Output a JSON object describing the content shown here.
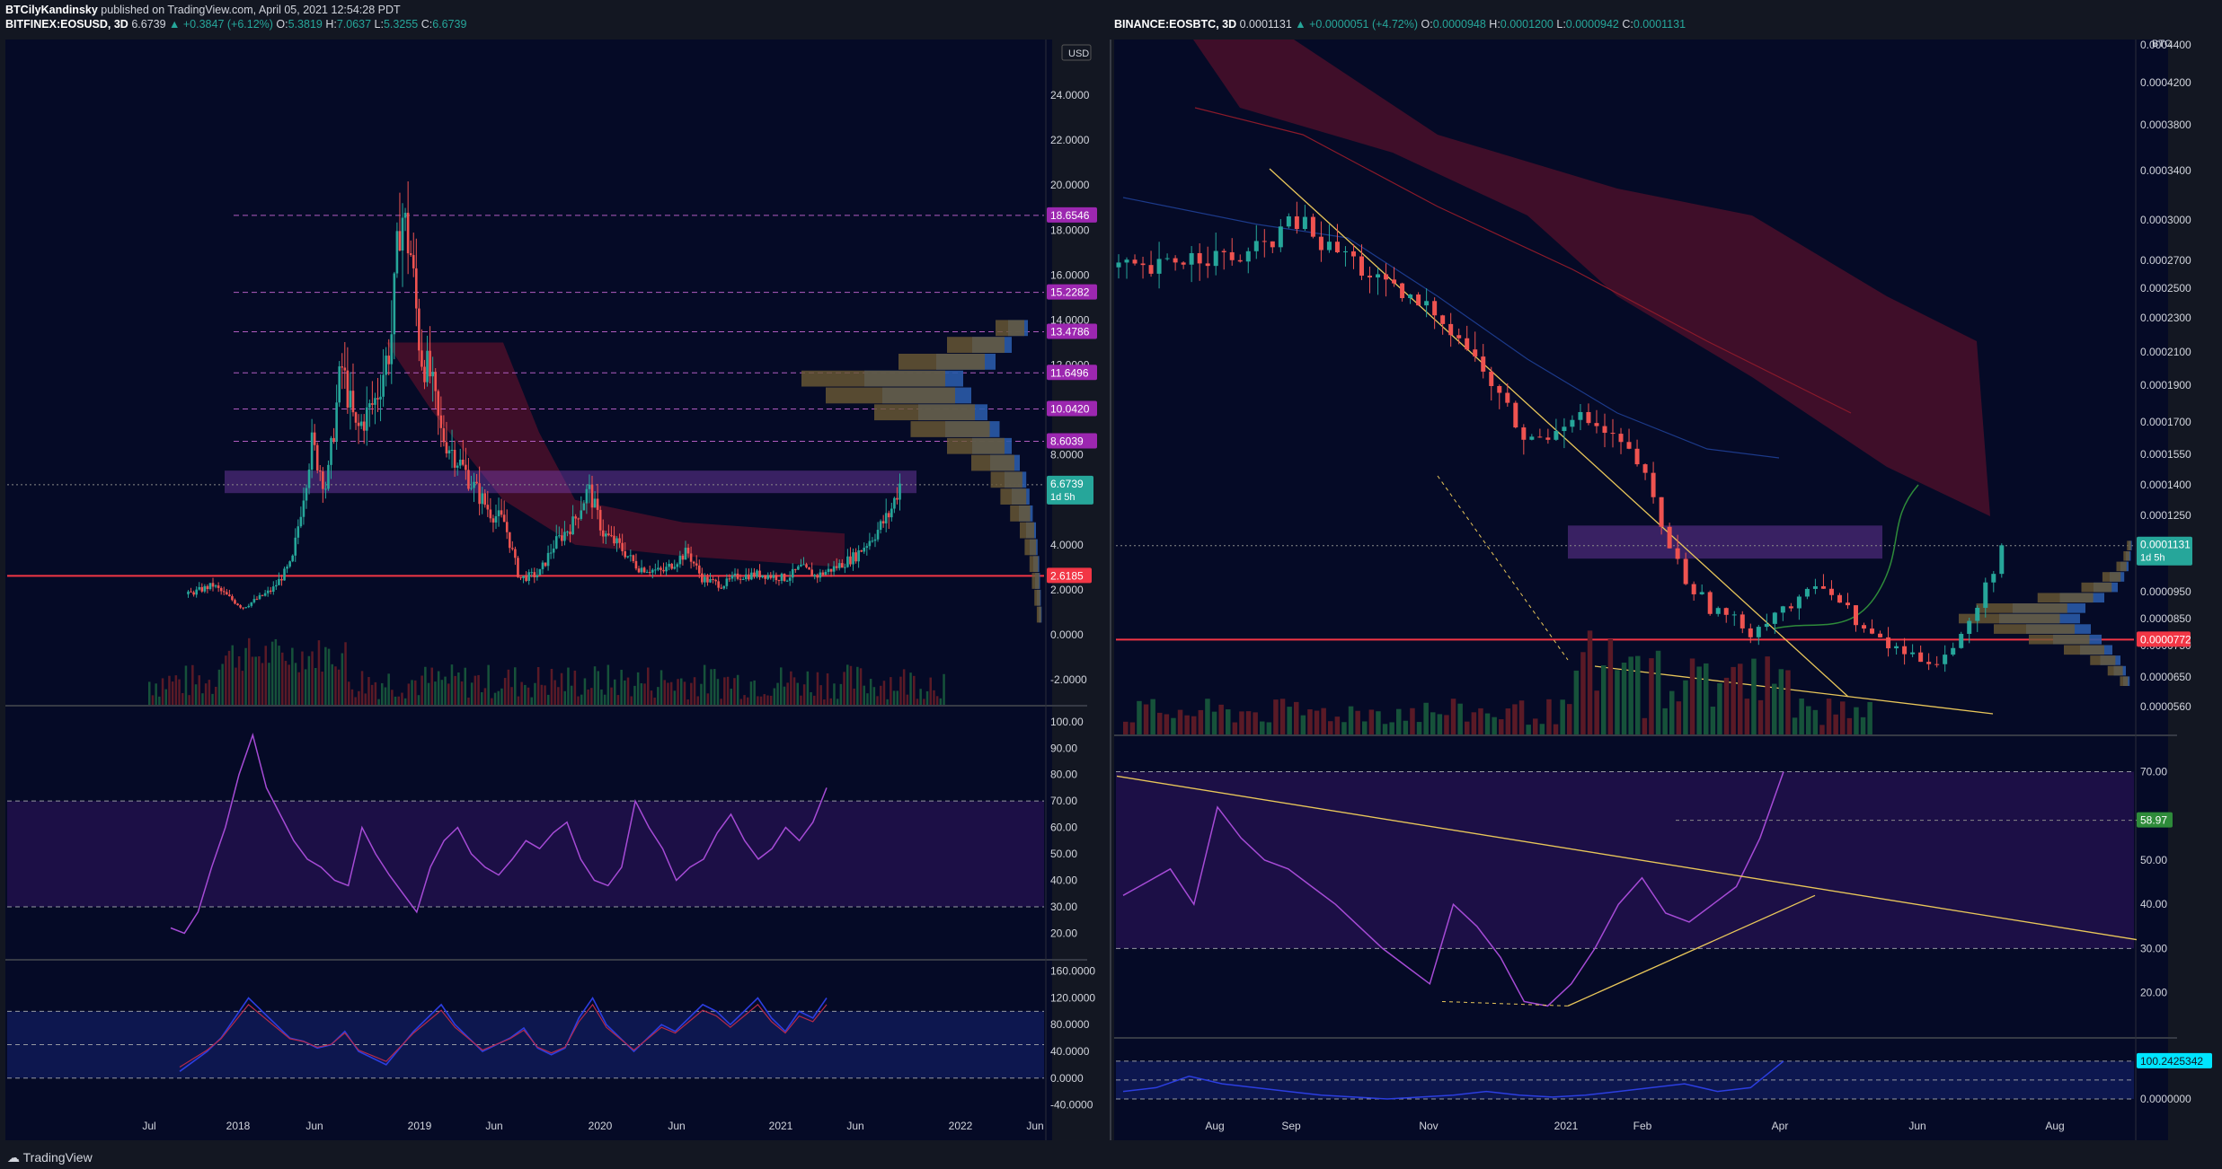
{
  "header": {
    "author": "BTCilyKandinsky",
    "published": "published on TradingView.com, April 05, 2021 12:54:28 PDT"
  },
  "left_chart": {
    "symbol": "BITFINEX:EOSUSD, 3D",
    "last": "6.6739",
    "change": "▲ +0.3847 (+6.12%)",
    "open": "5.3819",
    "high": "7.0637",
    "low": "5.3255",
    "close": "6.6739",
    "currency": "USD",
    "countdown": "1d 5h",
    "price_tag_color": "#26a69a",
    "level_tag_color": "#9c27b0",
    "support_color": "#f23645"
  },
  "right_chart": {
    "symbol": "BINANCE:EOSBTC, 3D",
    "last": "0.0001131",
    "change": "▲ +0.0000051 (+4.72%)",
    "open": "0.0000948",
    "high": "0.0001200",
    "low": "0.0000942",
    "close": "0.0001131",
    "currency": "BTC",
    "countdown": "1d 5h",
    "rsi_value": "58.97",
    "osc_value": "100.2425342"
  },
  "footer": {
    "brand": "TradingView"
  },
  "chart_data": [
    {
      "type": "candlestick",
      "panel": "left-price",
      "symbol": "BITFINEX:EOSUSD",
      "x_ticks": [
        "Jul",
        "2018",
        "Jun",
        "2019",
        "Jun",
        "2020",
        "Jun",
        "2021",
        "Jun",
        "2022",
        "Jun"
      ],
      "y_ticks": [
        "24.0000",
        "22.0000",
        "20.0000",
        "18.0000",
        "16.0000",
        "14.0000",
        "12.0000",
        "10.0000",
        "8.0000",
        "4.0000",
        "2.0000",
        "0.0000",
        "-2.0000"
      ],
      "ylim": [
        -2,
        26
      ],
      "level_labels": [
        "18.6546",
        "15.2282",
        "13.4786",
        "11.6496",
        "10.0420",
        "8.6039"
      ],
      "level_values": [
        18.6546,
        15.2282,
        13.4786,
        11.6496,
        10.042,
        8.6039
      ],
      "support_label": "2.6185",
      "support_value": 2.6185,
      "last_value": 6.6739,
      "close_path": [
        [
          0.9,
          1.8
        ],
        [
          1.4,
          2.2
        ],
        [
          2.0,
          1.2
        ],
        [
          2.6,
          2.0
        ],
        [
          3.0,
          3.2
        ],
        [
          3.4,
          8.5
        ],
        [
          3.7,
          6.5
        ],
        [
          4.0,
          12.0
        ],
        [
          4.3,
          9.0
        ],
        [
          4.7,
          10.5
        ],
        [
          5.0,
          13.0
        ],
        [
          5.2,
          19.0
        ],
        [
          5.4,
          17.0
        ],
        [
          5.6,
          12.5
        ],
        [
          5.8,
          11.5
        ],
        [
          6.0,
          9.0
        ],
        [
          6.3,
          8.0
        ],
        [
          6.7,
          6.5
        ],
        [
          7.0,
          5.5
        ],
        [
          7.3,
          5.0
        ],
        [
          7.6,
          2.5
        ],
        [
          8.0,
          2.7
        ],
        [
          8.3,
          4.0
        ],
        [
          8.7,
          5.0
        ],
        [
          9.0,
          6.5
        ],
        [
          9.3,
          4.5
        ],
        [
          9.6,
          4.0
        ],
        [
          10.0,
          3.0
        ],
        [
          10.5,
          2.8
        ],
        [
          11.0,
          3.7
        ],
        [
          11.3,
          2.5
        ],
        [
          11.7,
          2.2
        ],
        [
          12.0,
          2.6
        ],
        [
          12.5,
          2.7
        ],
        [
          13.0,
          2.5
        ],
        [
          13.3,
          3.0
        ],
        [
          13.6,
          2.6
        ],
        [
          14.0,
          3.0
        ],
        [
          14.4,
          3.5
        ],
        [
          14.8,
          4.5
        ],
        [
          15.1,
          5.4
        ],
        [
          15.3,
          6.7
        ]
      ],
      "volume_profile_pct": [
        0.2,
        0.4,
        0.6,
        1.0,
        0.9,
        0.7,
        0.55,
        0.4,
        0.3,
        0.22,
        0.18,
        0.14,
        0.1,
        0.08,
        0.06,
        0.05,
        0.04,
        0.03
      ]
    },
    {
      "type": "line",
      "panel": "left-rsi",
      "y_ticks": [
        "100.00",
        "90.00",
        "80.00",
        "70.00",
        "60.00",
        "50.00",
        "40.00",
        "30.00",
        "20.00"
      ],
      "ylim": [
        13,
        103
      ],
      "bands": [
        30,
        70
      ],
      "values": [
        22,
        20,
        28,
        45,
        60,
        80,
        95,
        75,
        65,
        55,
        48,
        45,
        40,
        38,
        60,
        50,
        42,
        35,
        28,
        45,
        55,
        60,
        50,
        45,
        42,
        48,
        55,
        52,
        58,
        62,
        48,
        40,
        38,
        45,
        70,
        60,
        52,
        40,
        45,
        48,
        58,
        65,
        55,
        48,
        52,
        60,
        55,
        62,
        75
      ]
    },
    {
      "type": "line",
      "panel": "left-osc",
      "y_ticks": [
        "160.0000",
        "120.0000",
        "80.0000",
        "40.0000",
        "0.0000",
        "-40.0000"
      ],
      "ylim": [
        -42,
        165
      ],
      "bands": [
        0,
        50,
        100
      ],
      "values": [
        10,
        25,
        40,
        60,
        90,
        120,
        100,
        80,
        60,
        55,
        45,
        50,
        70,
        40,
        30,
        20,
        45,
        70,
        90,
        110,
        80,
        60,
        40,
        50,
        60,
        75,
        45,
        35,
        45,
        90,
        120,
        80,
        60,
        40,
        60,
        80,
        70,
        90,
        110,
        100,
        80,
        100,
        120,
        90,
        70,
        100,
        90,
        120
      ]
    },
    {
      "type": "candlestick",
      "panel": "right-price",
      "symbol": "BINANCE:EOSBTC",
      "x_ticks": [
        "Aug",
        "Sep",
        "Nov",
        "2021",
        "Feb",
        "Apr",
        "Jun",
        "Aug"
      ],
      "y_ticks": [
        "0.0004400",
        "0.0004200",
        "0.0003800",
        "0.0003400",
        "0.0003000",
        "0.0002700",
        "0.0002500",
        "0.0002300",
        "0.0002100",
        "0.0001900",
        "0.0001700",
        "0.0001550",
        "0.0001400",
        "0.0001250",
        "0.0000950",
        "0.0000850",
        "0.0000750",
        "0.0000650",
        "0.0000560"
      ],
      "ylim": [
        5e-05,
        0.00045
      ],
      "support_label": "0.0000772",
      "support_value": 7.72e-05,
      "last_value": 0.0001131,
      "close_path": [
        [
          0.0,
          0.000265
        ],
        [
          0.5,
          0.00026
        ],
        [
          1.0,
          0.00027
        ],
        [
          1.5,
          0.000275
        ],
        [
          2.0,
          0.00027
        ],
        [
          2.4,
          0.000275
        ],
        [
          2.8,
          0.00029
        ],
        [
          3.2,
          0.0003
        ],
        [
          3.6,
          0.00028
        ],
        [
          4.0,
          0.000275
        ],
        [
          4.4,
          0.00026
        ],
        [
          4.8,
          0.000248
        ],
        [
          5.2,
          0.00024
        ],
        [
          5.6,
          0.000235
        ],
        [
          6.0,
          0.00022
        ],
        [
          6.4,
          0.0002
        ],
        [
          6.8,
          0.00018
        ],
        [
          7.2,
          0.00016
        ],
        [
          7.6,
          0.000165
        ],
        [
          8.0,
          0.000175
        ],
        [
          8.4,
          0.000168
        ],
        [
          8.8,
          0.00016
        ],
        [
          9.2,
          0.00015
        ],
        [
          9.6,
          0.00012
        ],
        [
          10.0,
          0.0001
        ],
        [
          10.4,
          9e-05
        ],
        [
          10.8,
          8.5e-05
        ],
        [
          11.2,
          8e-05
        ],
        [
          11.6,
          8.8e-05
        ],
        [
          12.0,
          9e-05
        ],
        [
          12.4,
          0.0001
        ],
        [
          12.8,
          9e-05
        ],
        [
          13.2,
          8e-05
        ],
        [
          13.6,
          7.5e-05
        ],
        [
          14.0,
          7.2e-05
        ],
        [
          14.4,
          7e-05
        ],
        [
          14.8,
          7.5e-05
        ],
        [
          15.2,
          9e-05
        ],
        [
          15.6,
          0.000113
        ]
      ],
      "volume_profile_pct": [
        0.04,
        0.06,
        0.1,
        0.18,
        0.3,
        0.55,
        0.9,
        1.0,
        0.8,
        0.6,
        0.4,
        0.25,
        0.15,
        0.08
      ]
    },
    {
      "type": "line",
      "panel": "right-rsi",
      "y_ticks": [
        "70.00",
        "50.00",
        "40.00",
        "30.00",
        "20.00"
      ],
      "ylim": [
        12,
        76
      ],
      "bands": [
        30,
        70
      ],
      "values": [
        42,
        45,
        48,
        40,
        62,
        55,
        50,
        48,
        44,
        40,
        35,
        30,
        26,
        22,
        40,
        35,
        28,
        18,
        17,
        22,
        30,
        40,
        46,
        38,
        36,
        40,
        44,
        55,
        70
      ]
    },
    {
      "type": "line",
      "panel": "right-osc",
      "y_ticks": [
        "0.0000000"
      ],
      "values": [
        20,
        30,
        60,
        40,
        30,
        20,
        10,
        5,
        0,
        5,
        10,
        20,
        10,
        5,
        10,
        20,
        30,
        40,
        20,
        30,
        100
      ]
    }
  ]
}
